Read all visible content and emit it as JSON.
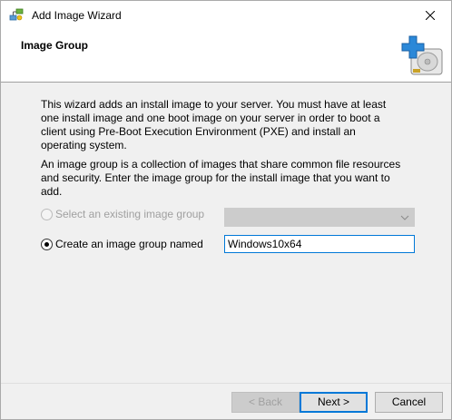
{
  "window": {
    "title": "Add Image Wizard"
  },
  "header": {
    "heading": "Image Group"
  },
  "body": {
    "intro": "This wizard adds an install image to your server. You must have at least one install image and one boot image on your server in order to boot a client using Pre-Boot Execution Environment (PXE) and install an operating system.",
    "group_desc": "An image group is a collection of images that share common file resources and security. Enter the image group for the install image that you want to add."
  },
  "options": {
    "existing": {
      "label": "Select an existing image group",
      "selected": false,
      "enabled": false
    },
    "create": {
      "label": "Create an image group named",
      "selected": true,
      "enabled": true
    }
  },
  "existing_group_select": {
    "value": ""
  },
  "group_name_input": {
    "value": "Windows10x64"
  },
  "buttons": {
    "back": "< Back",
    "next": "Next >",
    "cancel": "Cancel"
  },
  "icons": {
    "app": "network-computer-icon",
    "close": "close-icon",
    "wizard": "disk-add-icon",
    "dropdown": "chevron-down-icon"
  }
}
